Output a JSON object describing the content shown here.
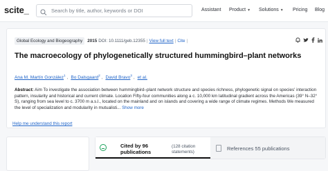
{
  "header": {
    "logo": "scite_",
    "search_placeholder": "Search by title, author, keywords or DOI",
    "nav": [
      {
        "label": "Assistant",
        "dropdown": false
      },
      {
        "label": "Product",
        "dropdown": true
      },
      {
        "label": "Solutions",
        "dropdown": true
      },
      {
        "label": "Pricing",
        "dropdown": false
      },
      {
        "label": "Blog",
        "dropdown": false
      }
    ]
  },
  "paper": {
    "journal": "Global Ecology and Biogeography",
    "year": "2015",
    "doi": "DOI: 10.1111/geb.12355",
    "view_full_text": "View full text",
    "cite": "Cite",
    "share_icons": [
      "bell-icon",
      "twitter-icon",
      "facebook-icon",
      "linkedin-icon"
    ],
    "title": "The macroecology of phylogenetically structured hummingbird–plant networks",
    "authors": [
      {
        "name": "Ana M. Martín González",
        "sup": "1"
      },
      {
        "name": "Bo Dalsgaard",
        "sup": "2"
      },
      {
        "name": "David Bravo",
        "sup": "3"
      }
    ],
    "et_al": "et al.",
    "abstract_label": "Abstract:",
    "abstract_text": " Aim To investigate the association between hummingbird–plant network structure and species richness, phylogenetic signal on species' interaction pattern, insularity and historical and current climate. Location Fifty-four communities along a c. 10,000 km latitudinal gradient across the Americas (39° N–32° S), ranging from sea level to c. 3700 m a.s.l., located on the mainland and on islands and covering a wide range of climate regimes. Methods We measured the level of specialization and modularity in mutualisti...",
    "show_more": "Show more",
    "help_link": "Help me understand this report"
  },
  "tabs": {
    "cited_by": "Cited by 96 publications",
    "citation_statements": "(128 citation statements)",
    "references": "References 55 publications"
  },
  "colors": {
    "accent_link": "#1e63c8",
    "cited_icon": "#18a058"
  }
}
